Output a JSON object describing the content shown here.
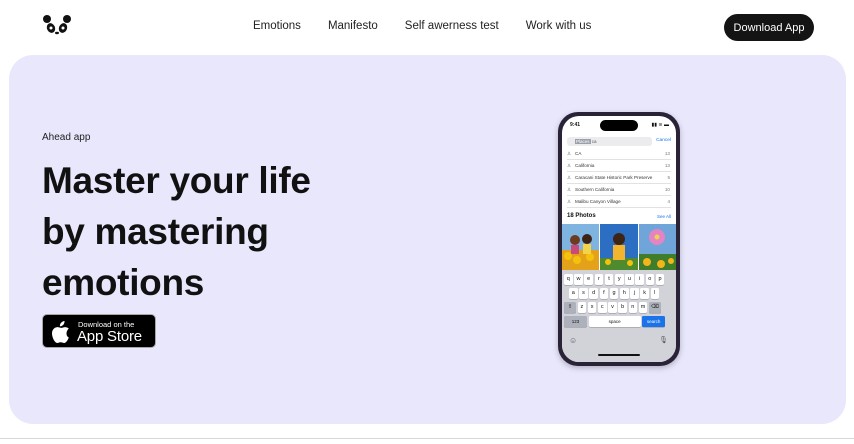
{
  "nav": {
    "links": [
      "Emotions",
      "Manifesto",
      "Self awerness test",
      "Work with us"
    ],
    "cta": "Download App"
  },
  "hero": {
    "eyebrow": "Ahead app",
    "headline": [
      "Master your life",
      "by mastering",
      "emotions"
    ],
    "appstore_small": "Download on the",
    "appstore_big": "App Store"
  },
  "phone": {
    "time": "9:41",
    "status_icons": "▮▮ ≋ ▬",
    "search_highlight": "Places",
    "search_query": "ca",
    "cancel": "Cancel",
    "results": [
      {
        "label": "CA",
        "count": "13"
      },
      {
        "label": "California",
        "count": "13"
      },
      {
        "label": "Caracani State Historic Park Preserve",
        "count": "5"
      },
      {
        "label": "Southern California",
        "count": "10"
      },
      {
        "label": "Malibu Canyon Village",
        "count": "4"
      }
    ],
    "photos_title": "18 Photos",
    "see_all": "See All",
    "keyboard": {
      "row1": [
        "q",
        "w",
        "e",
        "r",
        "t",
        "y",
        "u",
        "i",
        "o",
        "p"
      ],
      "row2": [
        "a",
        "s",
        "d",
        "f",
        "g",
        "h",
        "j",
        "k",
        "l"
      ],
      "row3": [
        "z",
        "x",
        "c",
        "v",
        "b",
        "n",
        "m"
      ],
      "num": "123",
      "space": "space",
      "search": "search"
    }
  },
  "colors": {
    "hero_bg": "#e9e7fc",
    "button_dark": "#141414",
    "accent_blue": "#1a73e8"
  }
}
